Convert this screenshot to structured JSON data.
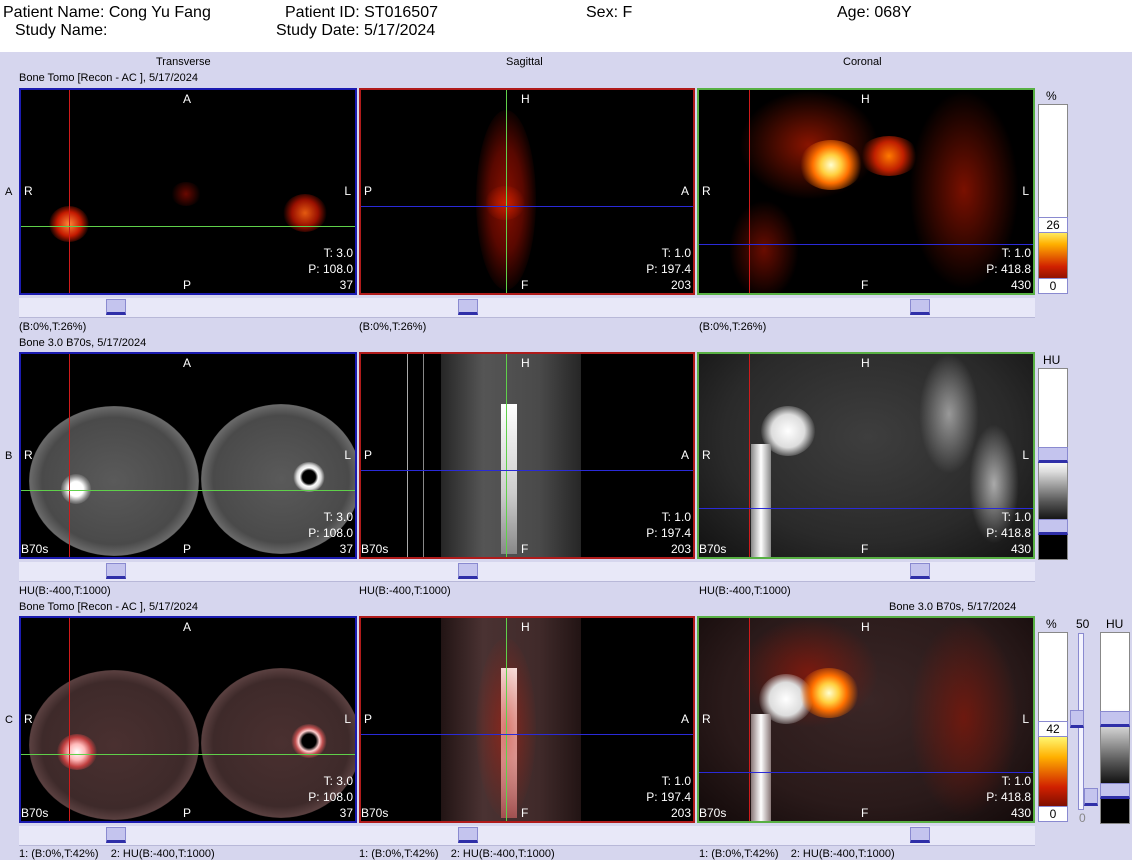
{
  "header": {
    "patient_name": "Patient Name: Cong Yu Fang",
    "study_name": "Study Name:",
    "patient_id": "Patient ID: ST016507",
    "study_date": "Study Date: 5/17/2024",
    "sex": "Sex: F",
    "age": "Age: 068Y"
  },
  "columns": [
    "Transverse",
    "Sagittal",
    "Coronal"
  ],
  "rows": [
    {
      "letter": "A",
      "series_left": "Bone Tomo [Recon - AC ], 5/17/2024",
      "series_right": "",
      "window_labels": [
        "(B:0%,T:26%)",
        "(B:0%,T:26%)",
        "(B:0%,T:26%)"
      ],
      "scale": {
        "unit": "%",
        "top": "26",
        "bottom": "0"
      }
    },
    {
      "letter": "B",
      "series_left": "Bone  3.0  B70s, 5/17/2024",
      "series_right": "",
      "window_labels": [
        "HU(B:-400,T:1000)",
        "HU(B:-400,T:1000)",
        "HU(B:-400,T:1000)"
      ],
      "scale": {
        "unit": "HU"
      }
    },
    {
      "letter": "C",
      "series_left": "Bone Tomo [Recon - AC ], 5/17/2024",
      "series_right": "Bone  3.0  B70s, 5/17/2024",
      "window_labels": [
        "1: (B:0%,T:42%)    2: HU(B:-400,T:1000)",
        "1: (B:0%,T:42%)    2: HU(B:-400,T:1000)",
        "1: (B:0%,T:42%)    2: HU(B:-400,T:1000)"
      ],
      "scale": {
        "unit": "%",
        "top": "42",
        "bottom": "0",
        "blend_top": "50",
        "blend_bottom": "0",
        "unit2": "HU"
      }
    }
  ],
  "views": {
    "transverse": {
      "top": "A",
      "bottom": "P",
      "left": "R",
      "right": "L",
      "t": "T: 3.0",
      "p": "P: 108.0",
      "slice": "37"
    },
    "sagittal": {
      "top": "H",
      "bottom": "F",
      "left": "P",
      "right": "A",
      "t": "T: 1.0",
      "p": "P: 197.4",
      "slice": "203"
    },
    "coronal": {
      "top": "H",
      "bottom": "F",
      "left": "R",
      "right": "L",
      "t": "T: 1.0",
      "p": "P: 418.8",
      "slice": "430"
    }
  },
  "kernel": "B70s",
  "colors": {
    "crosshair_red": "#d01a1a",
    "crosshair_green": "#5fd04a",
    "crosshair_blue": "#2a2ad8",
    "hot_high": "#ffffb0",
    "hot_mid": "#ff7a00",
    "hot_low": "#8a0a00"
  }
}
